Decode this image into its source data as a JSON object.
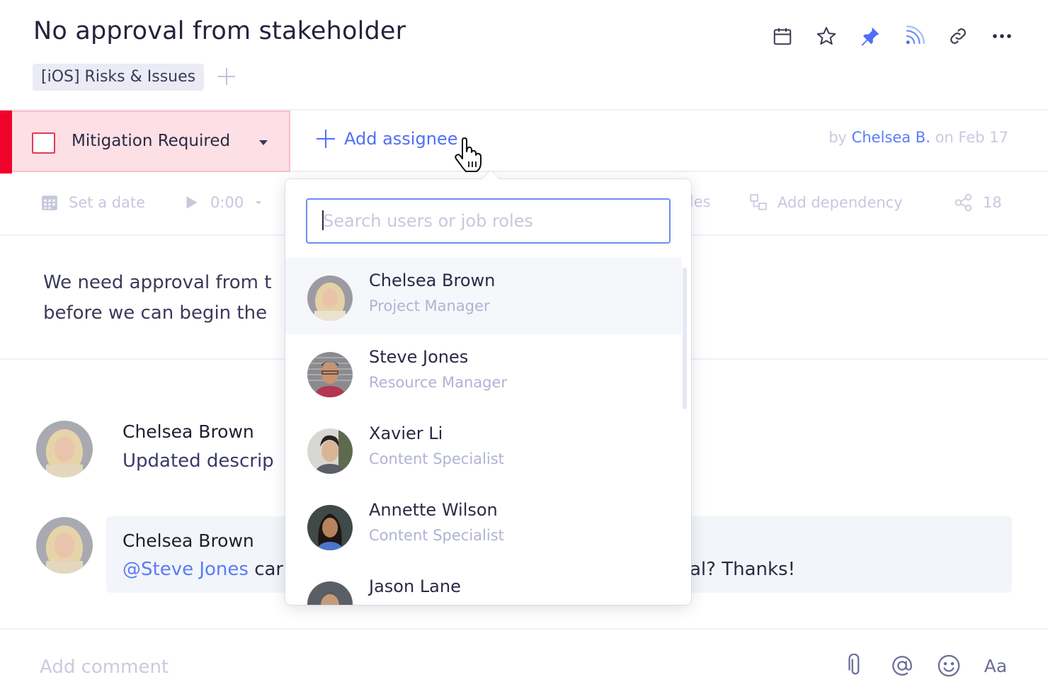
{
  "header": {
    "title": "No approval from stakeholder",
    "tag": "[iOS] Risks & Issues",
    "icons": [
      "calendar-icon",
      "star-icon",
      "pin-icon",
      "rss-follow-icon",
      "link-icon",
      "more-icon"
    ]
  },
  "status": {
    "label": "Mitigation Required",
    "color": "#f0032a"
  },
  "assignee": {
    "add_label": "Add assignee"
  },
  "created": {
    "prefix": "by",
    "author": "Chelsea B.",
    "suffix": "on Feb 17"
  },
  "toolbar": {
    "date_label": "Set a date",
    "time_label": "0:00",
    "files_label": "iles",
    "dependency_label": "Add dependency",
    "share_count": "18"
  },
  "description": {
    "line1": "We need approval from t",
    "line2": "before we can begin the"
  },
  "activity": [
    {
      "author": "Chelsea Brown",
      "text": "Updated descrip"
    },
    {
      "author": "Chelsea Brown",
      "mention": "@Steve Jones",
      "text_start": " car",
      "text_end": "al? Thanks!"
    }
  ],
  "composer": {
    "placeholder": "Add comment",
    "tools": [
      "attachment-icon",
      "mention-icon",
      "emoji-icon",
      "format-text-icon"
    ],
    "format_label": "Aa"
  },
  "dropdown": {
    "search_placeholder": "Search users or job roles",
    "search_value": "",
    "users": [
      {
        "name": "Chelsea Brown",
        "role": "Project Manager"
      },
      {
        "name": "Steve Jones",
        "role": "Resource Manager"
      },
      {
        "name": "Xavier Li",
        "role": "Content Specialist"
      },
      {
        "name": "Annette Wilson",
        "role": "Content Specialist"
      },
      {
        "name": "Jason Lane",
        "role": ""
      }
    ]
  },
  "colors": {
    "accent": "#4f6ef7",
    "status_bg": "#fde0e5",
    "status_stripe": "#f0032a"
  }
}
